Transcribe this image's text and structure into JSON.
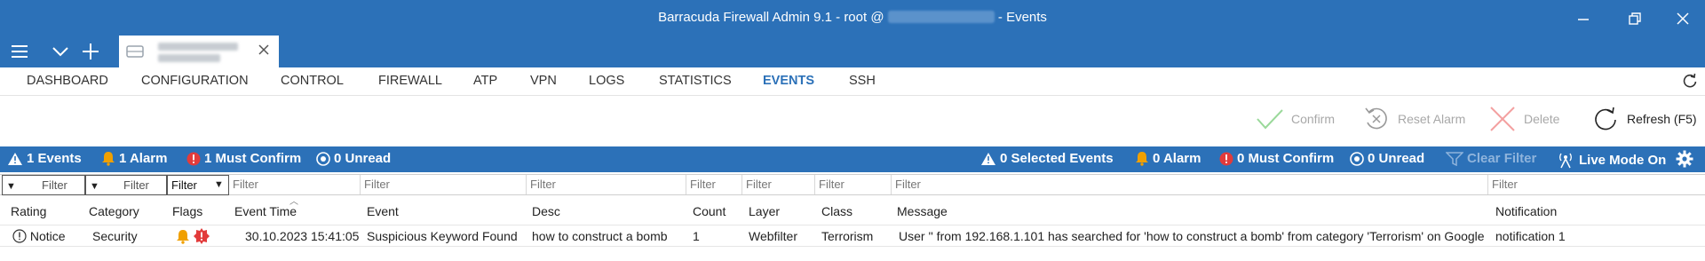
{
  "window": {
    "title_prefix": "Barracuda Firewall Admin 9.1 -  root @",
    "title_suffix": " - Events"
  },
  "nav": {
    "items": [
      {
        "label": "DASHBOARD",
        "name": "tab-dashboard"
      },
      {
        "label": "CONFIGURATION",
        "name": "tab-configuration"
      },
      {
        "label": "CONTROL",
        "name": "tab-control"
      },
      {
        "label": "FIREWALL",
        "name": "tab-firewall"
      },
      {
        "label": "ATP",
        "name": "tab-atp"
      },
      {
        "label": "VPN",
        "name": "tab-vpn"
      },
      {
        "label": "LOGS",
        "name": "tab-logs"
      },
      {
        "label": "STATISTICS",
        "name": "tab-statistics"
      },
      {
        "label": "EVENTS",
        "name": "tab-events",
        "active": true
      },
      {
        "label": "SSH",
        "name": "tab-ssh"
      }
    ]
  },
  "toolbar": {
    "confirm": "Confirm",
    "reset_alarm": "Reset Alarm",
    "delete": "Delete",
    "refresh": "Refresh (F5)"
  },
  "status": {
    "events": "1 Events",
    "alarm": "1 Alarm",
    "must_confirm": "1 Must Confirm",
    "unread": "0 Unread",
    "selected_events": "0 Selected Events",
    "sel_alarm": "0 Alarm",
    "sel_must_confirm": "0 Must Confirm",
    "sel_unread": "0 Unread",
    "clear_filter": "Clear Filter",
    "live_mode": "Live Mode On"
  },
  "filter": {
    "placeholder": "Filter"
  },
  "columns": {
    "rating": "Rating",
    "category": "Category",
    "flags": "Flags",
    "event_time": "Event Time",
    "event": "Event",
    "desc": "Desc",
    "count": "Count",
    "layer": "Layer",
    "class": "Class",
    "message": "Message",
    "notification": "Notification"
  },
  "rows": [
    {
      "rating": "Notice",
      "category": "Security",
      "event_time": "30.10.2023 15:41:05",
      "event": "Suspicious Keyword Found",
      "desc": "how to construct a bomb",
      "count": "1",
      "layer": "Webfilter",
      "class": "Terrorism",
      "message": "User '' from 192.168.1.101 has searched for 'how to construct a bomb' from category 'Terrorism' on Google",
      "notification": "notification 1"
    }
  ],
  "colors": {
    "brand_blue": "#2c71b8",
    "alarm_orange": "#f0a000",
    "confirm_red": "#e23b3b",
    "confirm_green": "#7fd07f",
    "delete_red": "#f08080"
  }
}
